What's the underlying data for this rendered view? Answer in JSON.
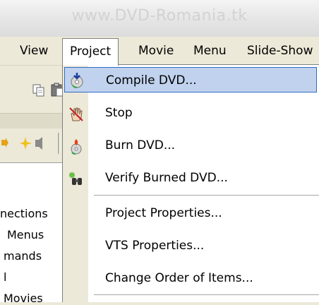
{
  "window": {
    "title": "www.DVD-Romania.tk"
  },
  "menubar": {
    "items": [
      {
        "label": "View"
      },
      {
        "label": "Project"
      },
      {
        "label": "Movie"
      },
      {
        "label": "Menu"
      },
      {
        "label": "Slide-Show"
      }
    ]
  },
  "project_menu": {
    "items": [
      {
        "label": "Compile DVD...",
        "icon": "compile-dvd-icon"
      },
      {
        "label": "Stop",
        "icon": "stop-hand-icon"
      },
      {
        "label": "Burn DVD...",
        "icon": "burn-disc-icon"
      },
      {
        "label": "Verify Burned DVD...",
        "icon": "verify-binoculars-icon"
      },
      {
        "label": "Project Properties..."
      },
      {
        "label": "VTS Properties..."
      },
      {
        "label": "Change Order of Items..."
      }
    ]
  },
  "left_panel": {
    "rows": [
      "nections",
      "Menus",
      "mands",
      "l",
      "Movies"
    ]
  },
  "colors": {
    "highlight_bg": "#c1d2ee",
    "highlight_border": "#316ac5",
    "menu_bg": "#ece9d8"
  }
}
